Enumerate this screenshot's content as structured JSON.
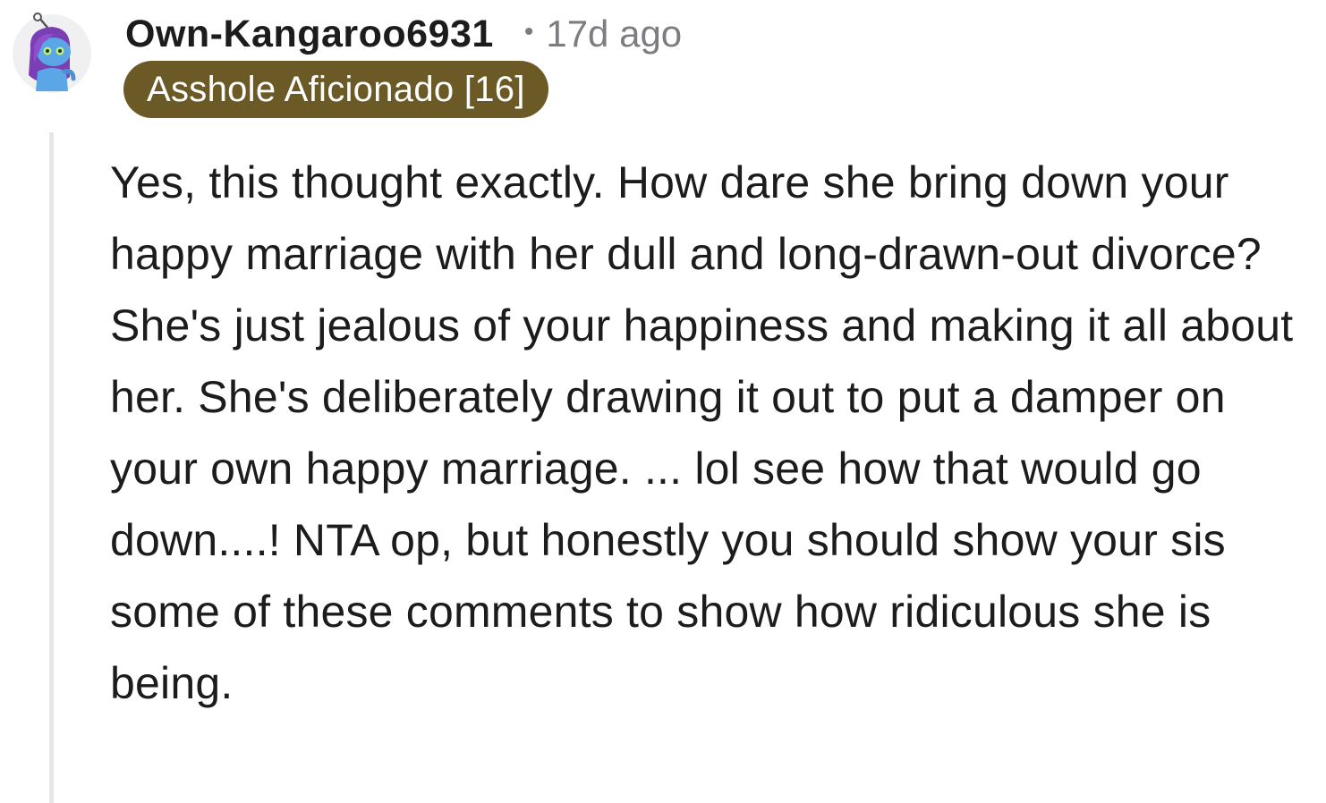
{
  "comment": {
    "author": "Own-Kangaroo6931",
    "separator": "•",
    "timestamp": "17d ago",
    "flair": "Asshole Aficionado [16]",
    "body": "Yes, this thought exactly. How dare she bring down your happy marriage with her dull and long-drawn-out divorce? She's just jealous of your happiness and making it all about her. She's deliberately drawing it out to put a damper on your own happy marriage. ... lol see how that would go down....! NTA op, but honestly you should show your sis some of these comments to show how ridiculous she is being.",
    "avatar_icon": "snoo-avatar-icon",
    "colors": {
      "flair_background": "#6c5a26",
      "flair_text": "#ffffff",
      "timestamp": "#7c7c83",
      "thread_line": "#e7e7ea",
      "avatar_hair": "#7b3fb5",
      "avatar_skin": "#5aa6e6"
    }
  }
}
